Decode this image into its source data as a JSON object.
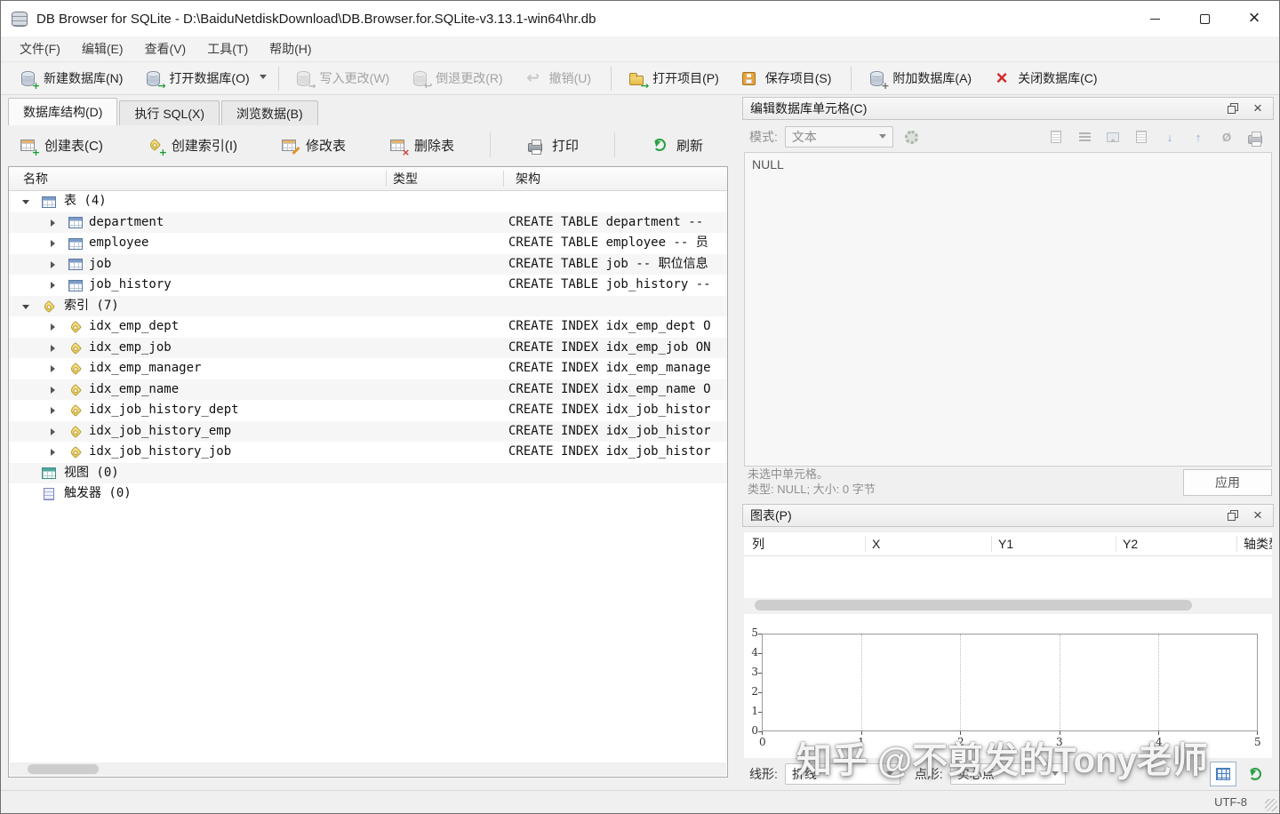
{
  "window": {
    "title": "DB Browser for SQLite - D:\\BaiduNetdiskDownload\\DB.Browser.for.SQLite-v3.13.1-win64\\hr.db"
  },
  "menu": {
    "items": [
      {
        "label": "文件(F)"
      },
      {
        "label": "编辑(E)"
      },
      {
        "label": "查看(V)"
      },
      {
        "label": "工具(T)"
      },
      {
        "label": "帮助(H)"
      }
    ]
  },
  "toolbar": {
    "new_db": "新建数据库(N)",
    "open_db": "打开数据库(O)",
    "write_changes": "写入更改(W)",
    "revert_changes": "倒退更改(R)",
    "undo": "撤销(U)",
    "open_project": "打开项目(P)",
    "save_project": "保存项目(S)",
    "attach_db": "附加数据库(A)",
    "close_db": "关闭数据库(C)"
  },
  "tabs": [
    {
      "label": "数据库结构(D)",
      "active": true
    },
    {
      "label": "执行 SQL(X)",
      "active": false
    },
    {
      "label": "浏览数据(B)",
      "active": false
    }
  ],
  "structure_toolbar": {
    "create_table": "创建表(C)",
    "create_index": "创建索引(I)",
    "modify_table": "修改表",
    "delete_table": "删除表",
    "print": "打印",
    "refresh": "刷新"
  },
  "tree": {
    "columns": [
      "名称",
      "类型",
      "架构"
    ],
    "groups": [
      {
        "label": "表 (4)",
        "items": [
          {
            "name": "department",
            "schema": "CREATE TABLE department --"
          },
          {
            "name": "employee",
            "schema": "CREATE TABLE employee -- 员"
          },
          {
            "name": "job",
            "schema": "CREATE TABLE job -- 职位信息"
          },
          {
            "name": "job_history",
            "schema": "CREATE TABLE job_history --"
          }
        ]
      },
      {
        "label": "索引 (7)",
        "items": [
          {
            "name": "idx_emp_dept",
            "schema": "CREATE INDEX idx_emp_dept O"
          },
          {
            "name": "idx_emp_job",
            "schema": "CREATE INDEX idx_emp_job ON"
          },
          {
            "name": "idx_emp_manager",
            "schema": "CREATE INDEX idx_emp_manage"
          },
          {
            "name": "idx_emp_name",
            "schema": "CREATE INDEX idx_emp_name O"
          },
          {
            "name": "idx_job_history_dept",
            "schema": "CREATE INDEX idx_job_histor"
          },
          {
            "name": "idx_job_history_emp",
            "schema": "CREATE INDEX idx_job_histor"
          },
          {
            "name": "idx_job_history_job",
            "schema": "CREATE INDEX idx_job_histor"
          }
        ]
      },
      {
        "label": "视图 (0)",
        "items": []
      },
      {
        "label": "触发器 (0)",
        "items": []
      }
    ]
  },
  "cell_editor": {
    "title": "编辑数据库单元格(C)",
    "mode_label": "模式:",
    "mode_value": "文本",
    "content": "NULL",
    "status_line1": "未选中单元格。",
    "status_line2": "类型: NULL; 大小: 0 字节",
    "apply_label": "应用"
  },
  "chart_panel": {
    "title": "图表(P)",
    "columns": [
      "列",
      "X",
      "Y1",
      "Y2",
      "轴类型"
    ],
    "line_label": "线形:",
    "line_value": "折线",
    "point_label": "点形:",
    "point_value": "实心点"
  },
  "chart_data": {
    "type": "line",
    "series": [],
    "title": "",
    "xlabel": "",
    "ylabel": "",
    "xlim": [
      0,
      5
    ],
    "ylim": [
      0,
      5
    ],
    "x_ticks": [
      "0",
      "1",
      "2",
      "3",
      "4",
      "5"
    ],
    "y_ticks": [
      "0",
      "1",
      "2",
      "3",
      "4",
      "5"
    ],
    "grid": true,
    "legend": false
  },
  "watermark": "知乎 @不剪发的Tony老师",
  "statusbar": {
    "encoding": "UTF-8"
  },
  "colors": {
    "close_db_red": "#d42a2a",
    "refresh_green": "#27a043",
    "accent_blue": "#4a7dbd",
    "tag_yellow": "#ecc94b",
    "table_header_orange": "#e8b269"
  }
}
